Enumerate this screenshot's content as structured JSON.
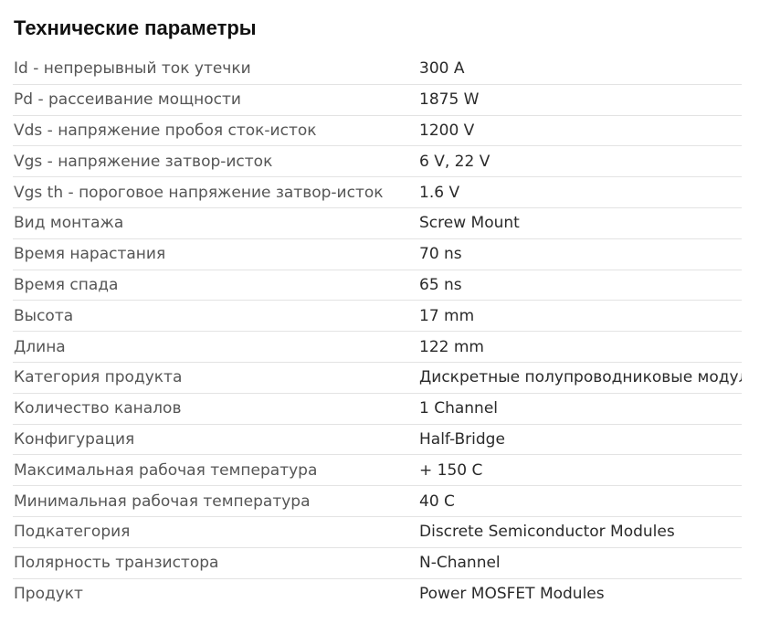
{
  "title": "Технические параметры",
  "specs": [
    {
      "name": "Id - непрерывный ток утечки",
      "value": "300 A"
    },
    {
      "name": "Pd - рассеивание мощности",
      "value": "1875 W"
    },
    {
      "name": "Vds - напряжение пробоя сток-исток",
      "value": "1200 V"
    },
    {
      "name": "Vgs - напряжение затвор-исток",
      "value": "6 V, 22 V"
    },
    {
      "name": "Vgs th - пороговое напряжение затвор-исток",
      "value": "1.6 V"
    },
    {
      "name": "Вид монтажа",
      "value": "Screw Mount"
    },
    {
      "name": "Время нарастания",
      "value": "70 ns"
    },
    {
      "name": "Время спада",
      "value": "65 ns"
    },
    {
      "name": "Высота",
      "value": "17 mm"
    },
    {
      "name": "Длина",
      "value": "122 mm"
    },
    {
      "name": "Категория продукта",
      "value": "Дискретные полупроводниковые модули"
    },
    {
      "name": "Количество каналов",
      "value": "1 Channel"
    },
    {
      "name": "Конфигурация",
      "value": "Half-Bridge"
    },
    {
      "name": "Максимальная рабочая температура",
      "value": "+ 150 C"
    },
    {
      "name": "Минимальная рабочая температура",
      "value": "40 C"
    },
    {
      "name": "Подкатегория",
      "value": "Discrete Semiconductor Modules"
    },
    {
      "name": "Полярность транзистора",
      "value": "N-Channel"
    },
    {
      "name": "Продукт",
      "value": "Power MOSFET Modules"
    }
  ]
}
